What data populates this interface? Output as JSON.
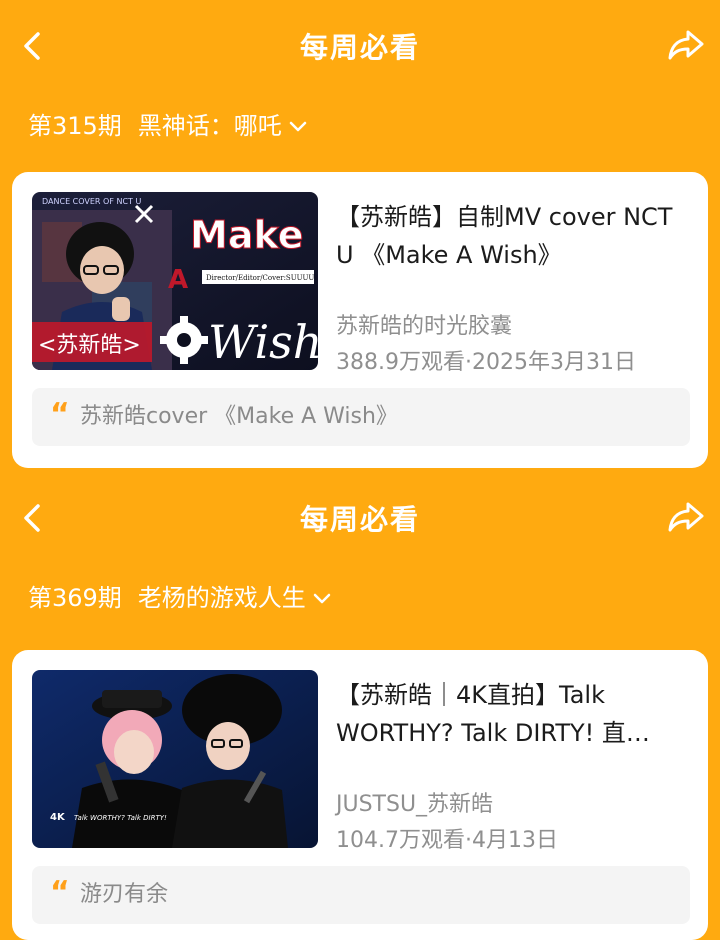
{
  "sections": [
    {
      "title": "每周必看",
      "issue_number": "第315期",
      "issue_name": "黑神话：哪吒",
      "video": {
        "title": "【苏新皓】自制MV cover NCT U 《Make A Wish》",
        "author": "苏新皓的时光胶囊",
        "meta": "388.9万观看·2025年3月31日",
        "thumbnail_text": {
          "top_left": "DANCE COVER OF NCT U",
          "make": "Make",
          "a": "A",
          "wish": "Wish",
          "credit": "Director/Editor/Cover:SUUUU",
          "name": "<苏新皓>"
        }
      },
      "quote": "苏新皓cover 《Make A Wish》"
    },
    {
      "title": "每周必看",
      "issue_number": "第369期",
      "issue_name": "老杨的游戏人生",
      "video": {
        "title": "【苏新皓｜4K直拍】Talk WORTHY? Talk DIRTY! 直…",
        "author": "JUSTSU_苏新皓",
        "meta": "104.7万观看·4月13日",
        "thumbnail_text": {
          "badge": "4K",
          "line": "Talk WORTHY? Talk DIRTY!"
        }
      },
      "quote": "游刃有余"
    }
  ],
  "colors": {
    "background": "#FFAA10",
    "card": "#ffffff",
    "quote_mark": "#FFA01A",
    "muted_text": "#8f8f8f"
  },
  "icons": [
    "back-arrow-icon",
    "share-icon",
    "chevron-down-icon",
    "quote-icon"
  ]
}
